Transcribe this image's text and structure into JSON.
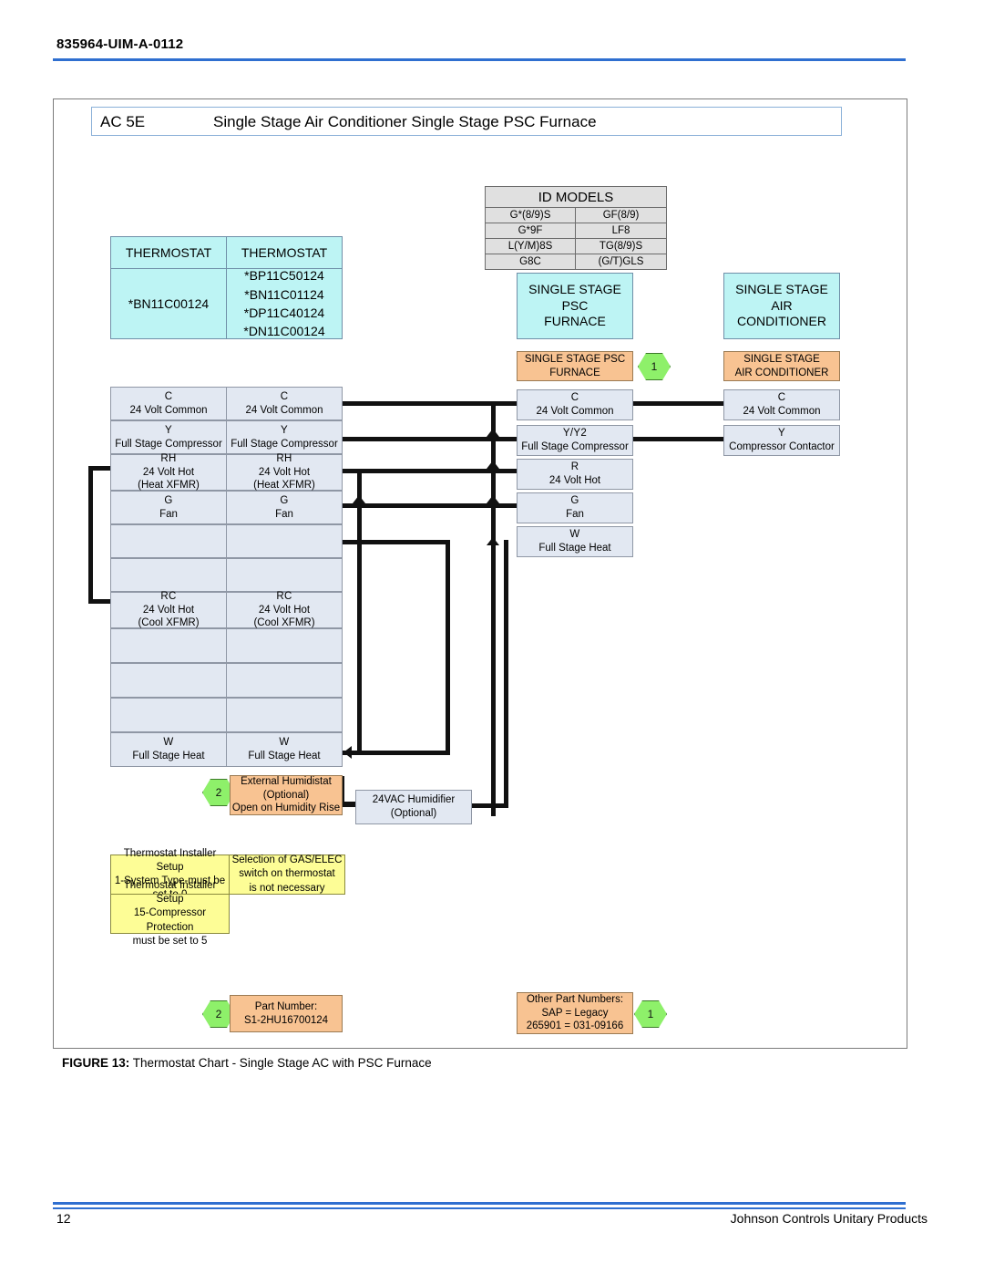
{
  "header": {
    "doc_code": "835964-UIM-A-0112"
  },
  "figure": {
    "title_left": "AC 5E",
    "title_main": "Single Stage Air Conditioner Single Stage PSC Furnace",
    "caption_label": "FIGURE 13:",
    "caption_text": "Thermostat Chart - Single Stage AC with PSC Furnace"
  },
  "id_models": {
    "header": "ID MODELS",
    "rows": [
      {
        "left": "G*(8/9)S",
        "right": "GF(8/9)"
      },
      {
        "left": "G*9F",
        "right": "LF8"
      },
      {
        "left": "L(Y/M)8S",
        "right": "TG(8/9)S"
      },
      {
        "left": "G8C",
        "right": "(G/T)GLS"
      }
    ]
  },
  "thermostats": {
    "col1": {
      "header": "THERMOSTAT",
      "models": "*BN11C00124"
    },
    "col2": {
      "header": "THERMOSTAT",
      "models": "*BP11C50124\n*BN11C01124\n*DP11C40124\n*DN11C00124"
    }
  },
  "equipment_titles": {
    "furnace": "SINGLE STAGE\nPSC\nFURNACE",
    "air_conditioner": "SINGLE STAGE\nAIR\nCONDITIONER"
  },
  "terminal_columns": {
    "thermostat_a": [
      {
        "code": "C",
        "desc": "24   Volt Common"
      },
      {
        "code": "Y",
        "desc": "Full Stage Compressor"
      },
      {
        "code": "RH",
        "desc": "24   Volt Hot",
        "desc2": "(Heat XFMR)"
      },
      {
        "code": "G",
        "desc": "Fan"
      },
      {
        "code": "",
        "desc": ""
      },
      {
        "code": "",
        "desc": ""
      },
      {
        "code": "RC",
        "desc": "24   Volt Hot",
        "desc2": "(Cool XFMR)"
      },
      {
        "code": "",
        "desc": ""
      },
      {
        "code": "",
        "desc": ""
      },
      {
        "code": "",
        "desc": ""
      },
      {
        "code": "W",
        "desc": "Full Stage Heat"
      }
    ],
    "thermostat_b": [
      {
        "code": "C",
        "desc": "24   Volt Common"
      },
      {
        "code": "Y",
        "desc": "Full Stage Compressor"
      },
      {
        "code": "RH",
        "desc": "24   Volt Hot",
        "desc2": "(Heat XFMR)"
      },
      {
        "code": "G",
        "desc": "Fan"
      },
      {
        "code": "",
        "desc": ""
      },
      {
        "code": "",
        "desc": ""
      },
      {
        "code": "RC",
        "desc": "24   Volt Hot",
        "desc2": "(Cool XFMR)"
      },
      {
        "code": "",
        "desc": ""
      },
      {
        "code": "",
        "desc": ""
      },
      {
        "code": "",
        "desc": ""
      },
      {
        "code": "W",
        "desc": "Full Stage Heat"
      }
    ],
    "furnace": {
      "header": "SINGLE STAGE PSC\nFURNACE",
      "rows": [
        {
          "code": "C",
          "desc": "24   Volt Common"
        },
        {
          "code": "Y/Y2",
          "desc": "Full Stage Compressor"
        },
        {
          "code": "R",
          "desc": "24   Volt Hot"
        },
        {
          "code": "G",
          "desc": "Fan"
        },
        {
          "code": "W",
          "desc": "Full Stage Heat"
        }
      ]
    },
    "air_conditioner": {
      "header": "SINGLE STAGE\nAIR CONDITIONER",
      "rows": [
        {
          "code": "C",
          "desc": "24   Volt Common"
        },
        {
          "code": "Y",
          "desc": "Compressor Contactor"
        }
      ]
    }
  },
  "accessories": {
    "humidistat": "External Humidistat\n(Optional)\nOpen on Humidity Rise",
    "humidifier": "24VAC Humidifier\n(Optional)"
  },
  "notes": {
    "note1": "Thermostat Installer Setup\n1-System Type-must be\nset to 0",
    "note2": "Selection of GAS/ELEC\nswitch on thermostat\nis not necessary",
    "note3": "Thermostat Installer Setup\n15-Compressor Protection\nmust be set to 5"
  },
  "part_numbers": {
    "left": "Part Number:\nS1-2HU16700124",
    "right": "Other Part Numbers:\nSAP    =    Legacy\n265901  =   031-09166"
  },
  "callouts": {
    "one": "1",
    "two": "2"
  },
  "footer": {
    "page_number": "12",
    "company": "Johnson Controls Unitary Products"
  },
  "colors": {
    "rule_blue": "#2f6fd0",
    "cyan_box": "#bdf4f4",
    "orange_box": "#f8c392",
    "gray_row": "#e2e8f2",
    "yellow_note": "#fdfd96",
    "hex_green": "#8ef06a"
  }
}
